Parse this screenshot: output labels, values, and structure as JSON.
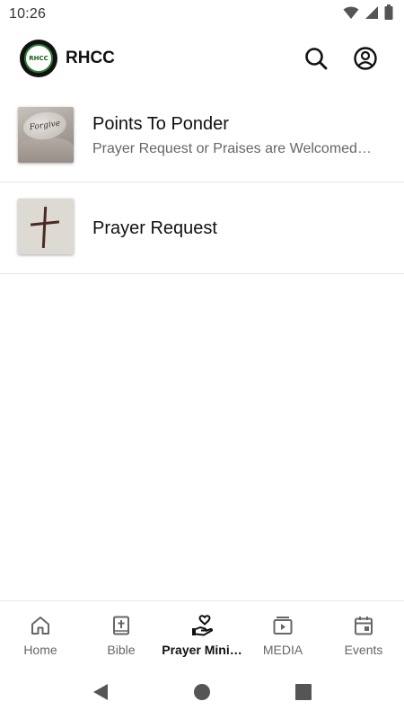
{
  "status_bar": {
    "time": "10:26"
  },
  "app_bar": {
    "logo_text": "RHCC",
    "title": "RHCC"
  },
  "list": {
    "items": [
      {
        "title": "Points To Ponder",
        "subtitle": "Prayer Request or Praises are Welcomed…",
        "thumbnail_text": "Forgive"
      },
      {
        "title": "Prayer Request",
        "subtitle": ""
      }
    ]
  },
  "bottom_nav": {
    "items": [
      {
        "label": "Home",
        "icon": "home-icon",
        "active": false
      },
      {
        "label": "Bible",
        "icon": "bible-icon",
        "active": false
      },
      {
        "label": "Prayer Mini…",
        "icon": "praying-hand-heart-icon",
        "active": true
      },
      {
        "label": "MEDIA",
        "icon": "media-icon",
        "active": false
      },
      {
        "label": "Events",
        "icon": "calendar-icon",
        "active": false
      }
    ]
  },
  "colors": {
    "active": "#111111",
    "inactive": "#666666",
    "divider": "#e6e6e6"
  }
}
